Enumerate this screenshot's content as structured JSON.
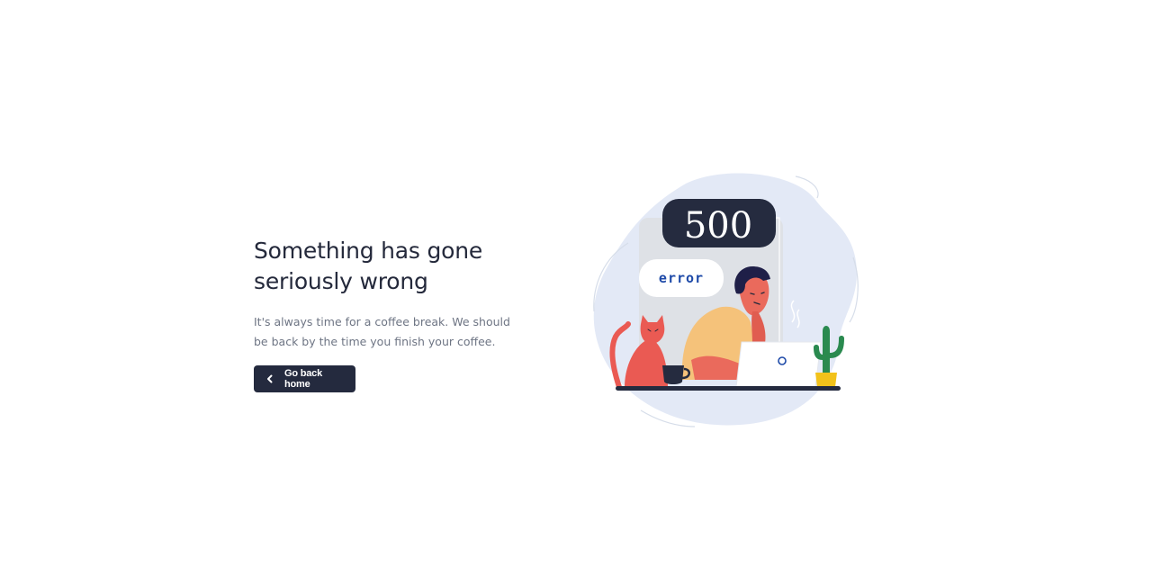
{
  "heading": "Something has gone seriously wrong",
  "description": "It's always time for a coffee break. We should be back by the time you finish your coffee.",
  "button": {
    "label": "Go back home",
    "icon": "chevron-left-icon"
  },
  "illustration": {
    "code": "500",
    "label": "error"
  },
  "colors": {
    "heading": "#24293b",
    "text": "#6e7584",
    "button_bg": "#242a3e",
    "blob": "#e3e9f6",
    "error_text": "#1e4aa8",
    "cat": "#ea5a53",
    "shirt": "#f5c27a",
    "cactus": "#2a8a4f",
    "pot": "#f2c21b"
  }
}
